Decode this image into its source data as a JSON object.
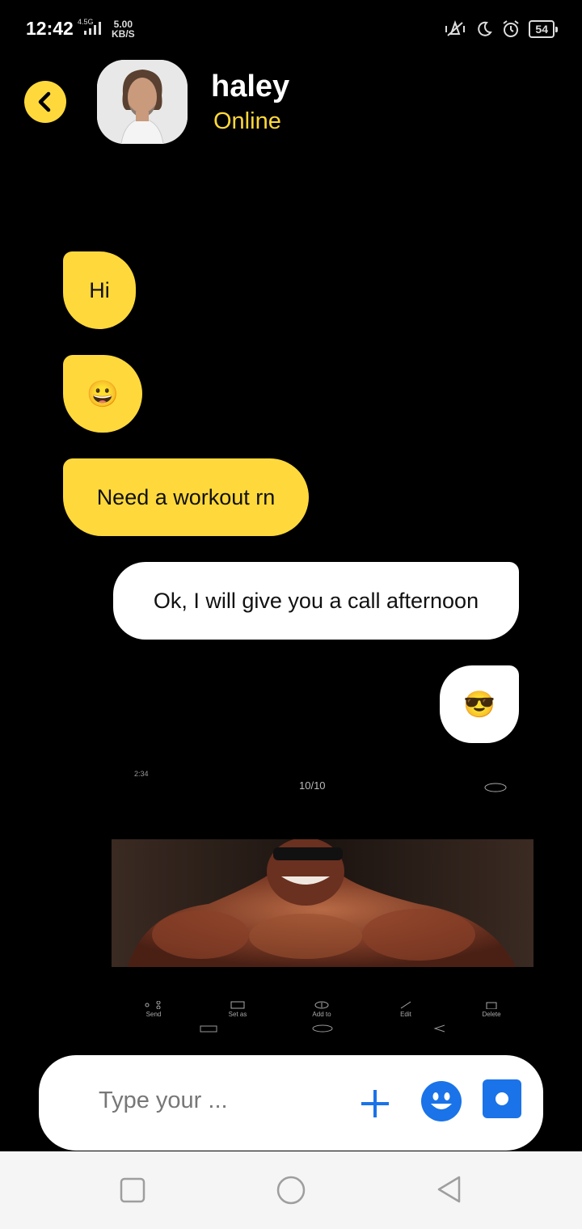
{
  "status_bar": {
    "time": "12:42",
    "network": "4.5G",
    "speed_value": "5.00",
    "speed_unit": "KB/S",
    "battery": "54"
  },
  "header": {
    "contact_name": "haley",
    "contact_status": "Online"
  },
  "messages": [
    {
      "direction": "incoming",
      "text": "Hi"
    },
    {
      "direction": "incoming",
      "text": "😀"
    },
    {
      "direction": "incoming",
      "text": "Need a workout rn"
    },
    {
      "direction": "outgoing",
      "text": "Ok, I will give you a call afternoon"
    },
    {
      "direction": "outgoing",
      "text": "😎"
    }
  ],
  "image_message": {
    "mini_time": "2:34",
    "counter": "10/10",
    "toolbar": [
      "Send",
      "Set as",
      "Add to",
      "Edit",
      "Delete"
    ]
  },
  "input": {
    "placeholder": "Type your ..."
  },
  "colors": {
    "accent": "#ffd93b",
    "icon_blue": "#1a73e8",
    "background": "#000000"
  }
}
